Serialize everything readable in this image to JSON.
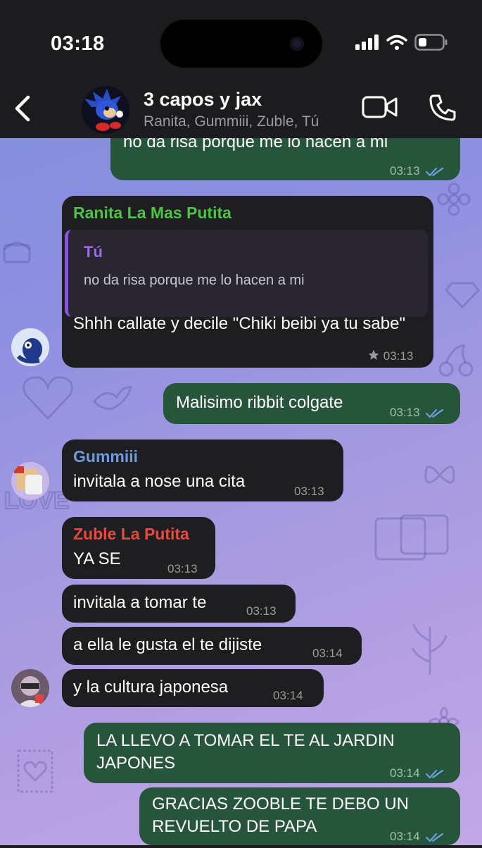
{
  "status": {
    "time": "03:18"
  },
  "header": {
    "title": "3 capos y jax",
    "subtitle": "Ranita, Gummiii, Zuble, Tú"
  },
  "colors": {
    "outgoing_bubble": "#27553b",
    "incoming_bubble": "#1e1e20",
    "ranita_name": "#4cc445",
    "gummiii_name": "#6b9be0",
    "zuble_name": "#e94a3c",
    "reply_accent": "#8a52e0"
  },
  "messages": [
    {
      "text": "no da risa porque me lo hacen a mi",
      "time": "03:13",
      "direction": "out",
      "status": "read"
    },
    {
      "sender": "Ranita La Mas Putita",
      "reply_to": {
        "name": "Tú",
        "text": "no da risa porque me lo hacen a mi"
      },
      "text": "Shhh callate y decile \"Chiki beibi ya tu sabe\"",
      "time": "03:13",
      "direction": "in",
      "starred": true
    },
    {
      "text": "Malisimo ribbit colgate",
      "time": "03:13",
      "direction": "out",
      "status": "read"
    },
    {
      "sender": "Gummiii",
      "text": "invitala a nose una cita",
      "time": "03:13",
      "direction": "in"
    },
    {
      "sender": "Zuble La Putita",
      "text": "YA SE",
      "time": "03:13",
      "direction": "in"
    },
    {
      "text": "invitala a tomar te",
      "time": "03:13",
      "direction": "in"
    },
    {
      "text": "a ella le gusta el te dijiste",
      "time": "03:14",
      "direction": "in"
    },
    {
      "text": "y la cultura japonesa",
      "time": "03:14",
      "direction": "in"
    },
    {
      "text": "LA LLEVO A TOMAR EL TE AL JARDIN JAPONES",
      "time": "03:14",
      "direction": "out",
      "status": "read"
    },
    {
      "text": "GRACIAS ZOOBLE TE DEBO UN REVUELTO DE PAPA",
      "time": "03:14",
      "direction": "out",
      "status": "read"
    }
  ],
  "icons": [
    "back-chevron-icon",
    "video-call-icon",
    "phone-call-icon",
    "signal-icon",
    "wifi-icon",
    "battery-icon",
    "star-icon",
    "double-check-icon"
  ]
}
